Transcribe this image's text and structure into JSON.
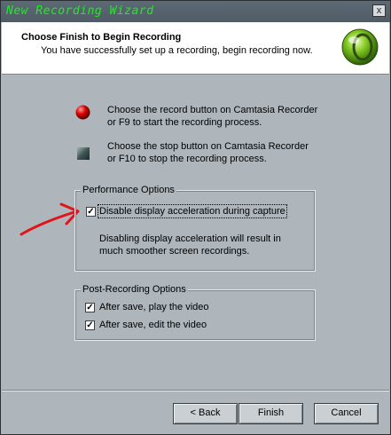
{
  "window": {
    "title": "New Recording Wizard",
    "close_glyph": "x"
  },
  "header": {
    "title": "Choose Finish to Begin Recording",
    "subtitle": "You have successfully set up a recording, begin recording now.",
    "icon": "wizard-logo-icon"
  },
  "instructions": {
    "record": [
      "Choose the record button on Camtasia Recorder",
      "or F9 to start the recording process."
    ],
    "stop": [
      "Choose the stop button on Camtasia Recorder",
      "or F10 to stop the recording process."
    ]
  },
  "performance": {
    "group_label": "Performance Options",
    "checkbox_label": "Disable display acceleration during capture",
    "checked": true,
    "note": [
      "Disabling display acceleration will result in",
      "much smoother screen recordings."
    ]
  },
  "post_recording": {
    "group_label": "Post-Recording Options",
    "options": [
      {
        "label": "After save, play the video",
        "checked": true
      },
      {
        "label": "After save, edit the video",
        "checked": true
      }
    ]
  },
  "buttons": {
    "back": "< Back",
    "finish": "Finish",
    "cancel": "Cancel"
  },
  "colors": {
    "title_text": "#27e62a",
    "annotation_arrow": "#e0141a",
    "record": "#cc0000"
  }
}
